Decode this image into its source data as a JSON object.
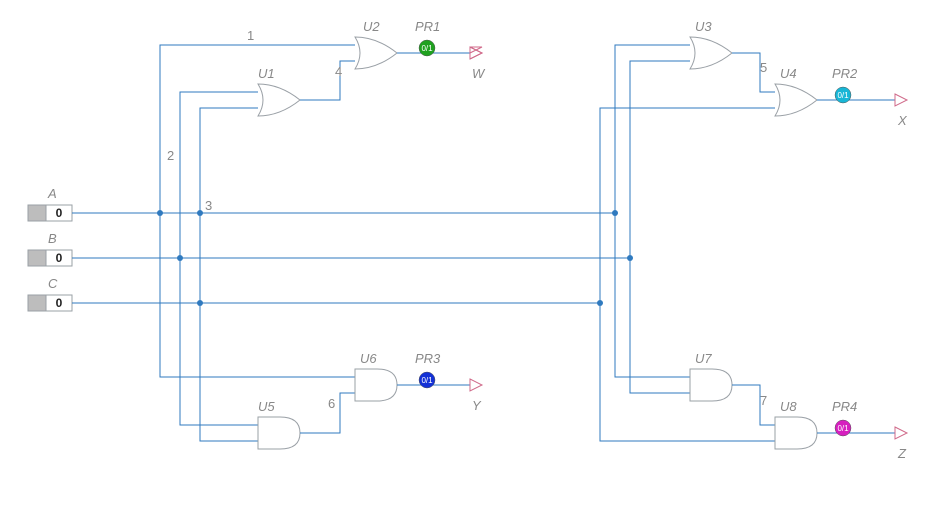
{
  "chart_data": {
    "type": "diagram",
    "title": "",
    "notes": "Combinational logic circuit with three binary inputs (A,B,C) driving eight gates (U1–U8) and four probed outputs (W,X,Y,Z).",
    "inputs": [
      {
        "name": "A",
        "value": "0"
      },
      {
        "name": "B",
        "value": "0"
      },
      {
        "name": "C",
        "value": "0"
      }
    ],
    "gates": [
      {
        "ref": "U1",
        "type": "OR"
      },
      {
        "ref": "U2",
        "type": "OR"
      },
      {
        "ref": "U3",
        "type": "OR"
      },
      {
        "ref": "U4",
        "type": "OR"
      },
      {
        "ref": "U5",
        "type": "AND"
      },
      {
        "ref": "U6",
        "type": "AND"
      },
      {
        "ref": "U7",
        "type": "AND"
      },
      {
        "ref": "U8",
        "type": "AND"
      }
    ],
    "nets": [
      {
        "id": "1"
      },
      {
        "id": "2"
      },
      {
        "id": "3"
      },
      {
        "id": "4"
      },
      {
        "id": "5"
      },
      {
        "id": "6"
      },
      {
        "id": "7"
      }
    ],
    "probes": [
      {
        "ref": "PR1",
        "color": "#1fa11f",
        "value": "0/1"
      },
      {
        "ref": "PR2",
        "color": "#18b6d6",
        "value": "0/1"
      },
      {
        "ref": "PR3",
        "color": "#1431d6",
        "value": "0/1"
      },
      {
        "ref": "PR4",
        "color": "#d61fbf",
        "value": "0/1"
      }
    ],
    "outputs": [
      {
        "name": "W"
      },
      {
        "name": "X"
      },
      {
        "name": "Y"
      },
      {
        "name": "Z"
      }
    ]
  },
  "labels": {
    "U1": "U1",
    "U2": "U2",
    "U3": "U3",
    "U4": "U4",
    "U5": "U5",
    "U6": "U6",
    "U7": "U7",
    "U8": "U8",
    "PR1": "PR1",
    "PR2": "PR2",
    "PR3": "PR3",
    "PR4": "PR4",
    "A": "A",
    "B": "B",
    "C": "C",
    "W": "W",
    "X": "X",
    "Y": "Y",
    "Z": "Z",
    "n1": "1",
    "n2": "2",
    "n3": "3",
    "n4": "4",
    "n5": "5",
    "n6": "6",
    "n7": "7",
    "valA": "0",
    "valB": "0",
    "valC": "0",
    "pv1": "0/1",
    "pv2": "0/1",
    "pv3": "0/1",
    "pv4": "0/1"
  }
}
